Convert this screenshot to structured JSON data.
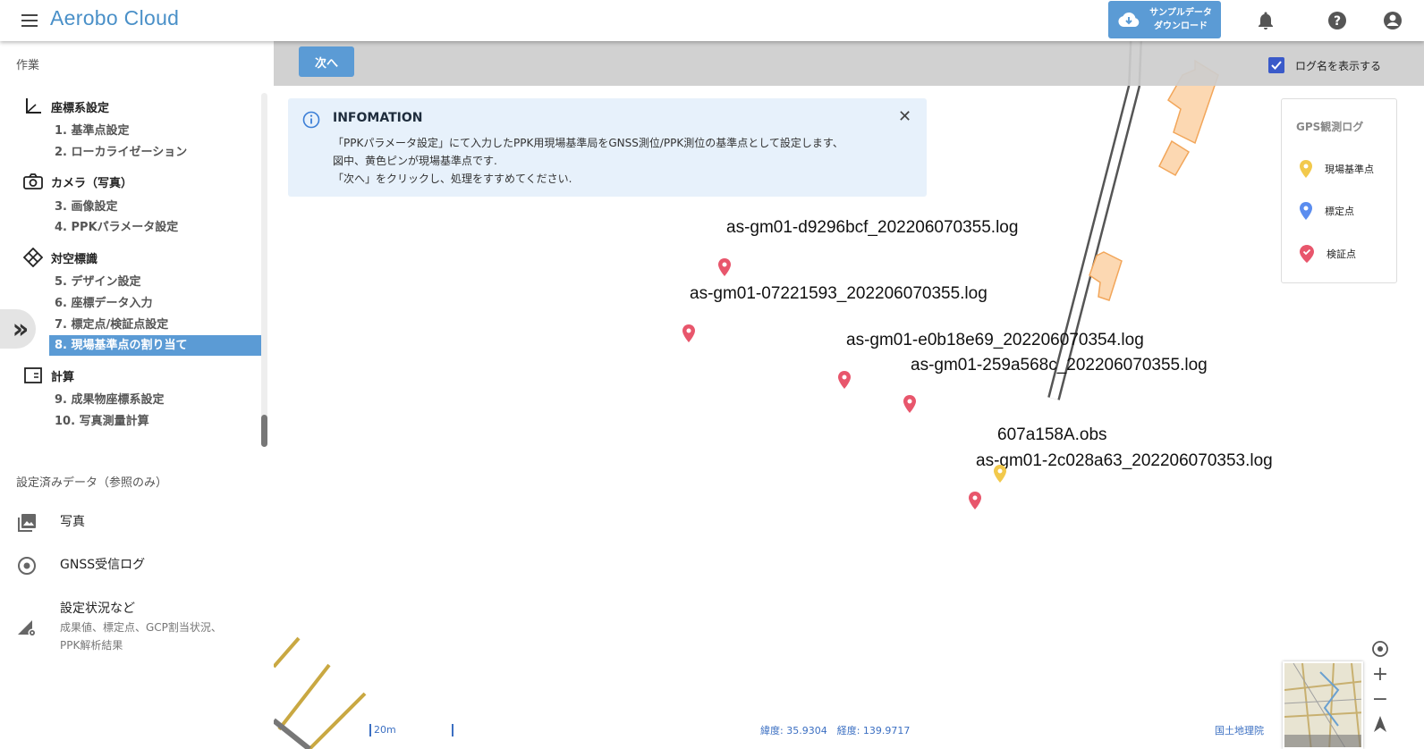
{
  "header": {
    "app_title": "Aerobo Cloud",
    "download_line1": "サンプルデータ",
    "download_line2": "ダウンロード"
  },
  "sidebar": {
    "section_work": "作業",
    "groups": [
      {
        "label": "座標系設定"
      },
      {
        "label": "カメラ（写真）"
      },
      {
        "label": "対空標識"
      },
      {
        "label": "計算"
      }
    ],
    "steps": [
      {
        "num": "1.",
        "label": "基準点設定"
      },
      {
        "num": "2.",
        "label": "ローカライゼーション"
      },
      {
        "num": "3.",
        "label": "画像設定"
      },
      {
        "num": "4.",
        "label": "PPKパラメータ設定"
      },
      {
        "num": "5.",
        "label": "デザイン設定"
      },
      {
        "num": "6.",
        "label": "座標データ入力"
      },
      {
        "num": "7.",
        "label": "標定点/検証点設定"
      },
      {
        "num": "8.",
        "label": "現場基準点の割り当て"
      },
      {
        "num": "9.",
        "label": "成果物座標系設定"
      },
      {
        "num": "10.",
        "label": "写真測量計算"
      }
    ],
    "section_reference": "設定済みデータ（参照のみ）",
    "reference": [
      {
        "label": "写真"
      },
      {
        "label": "GNSS受信ログ"
      },
      {
        "label": "設定状況など",
        "sub_line1": "成果値、標定点、GCP割当状況、",
        "sub_line2": "PPK解析結果"
      }
    ]
  },
  "toolbar": {
    "next_label": "次へ",
    "show_log_names_label": "ログ名を表示する",
    "show_log_names_checked": true
  },
  "info": {
    "title": "INFOMATION",
    "body": "「PPKパラメータ設定」にて入力したPPK用現場基準局をGNSS測位/PPK測位の基準点として設定します、\n図中、黄色ピンが現場基準点です.\n「次へ」をクリックし、処理をすすめてください."
  },
  "legend": {
    "title": "GPS観測ログ",
    "items": [
      {
        "label": "現場基準点",
        "color": "#f2c94c"
      },
      {
        "label": "標定点",
        "color": "#5b8def"
      },
      {
        "label": "検証点",
        "color": "#e8566c"
      }
    ]
  },
  "map": {
    "log_labels": [
      "as-gm01-d9296bcf_202206070355.log",
      "as-gm01-07221593_202206070355.log",
      "as-gm01-e0b18e69_202206070354.log",
      "as-gm01-259a568c_202206070355.log",
      "607a158A.obs",
      "as-gm01-2c028a63_202206070353.log"
    ],
    "scale_label": "20m",
    "coordinates": "緯度: 35.9304　経度: 139.9717",
    "attribution": "国土地理院"
  },
  "colors": {
    "accent": "#5b9bd5",
    "pin_red": "#e8566c",
    "pin_yellow": "#f2c94c"
  }
}
